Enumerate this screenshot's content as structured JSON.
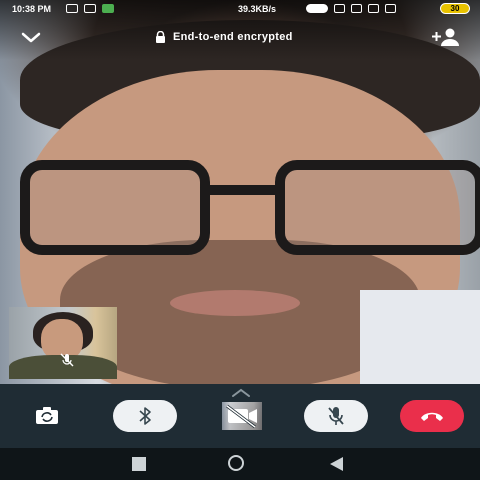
{
  "status_bar": {
    "time": "10:38 PM",
    "network_speed": "39.3KB/s",
    "battery": "30"
  },
  "header": {
    "encryption_label": "End-to-end encrypted"
  },
  "icons": {
    "collapse": "chevron-down-icon",
    "add_participant": "add-user-icon",
    "lock": "lock-icon",
    "switch_camera": "switch-camera-icon",
    "bluetooth": "bluetooth-icon",
    "video_off": "video-off-icon",
    "mic_off": "mic-off-icon",
    "end_call": "end-call-icon"
  },
  "colors": {
    "controls_bar": "#1f2c34",
    "end_call": "#ea2f4b",
    "pill_button": "#eef1f3"
  }
}
